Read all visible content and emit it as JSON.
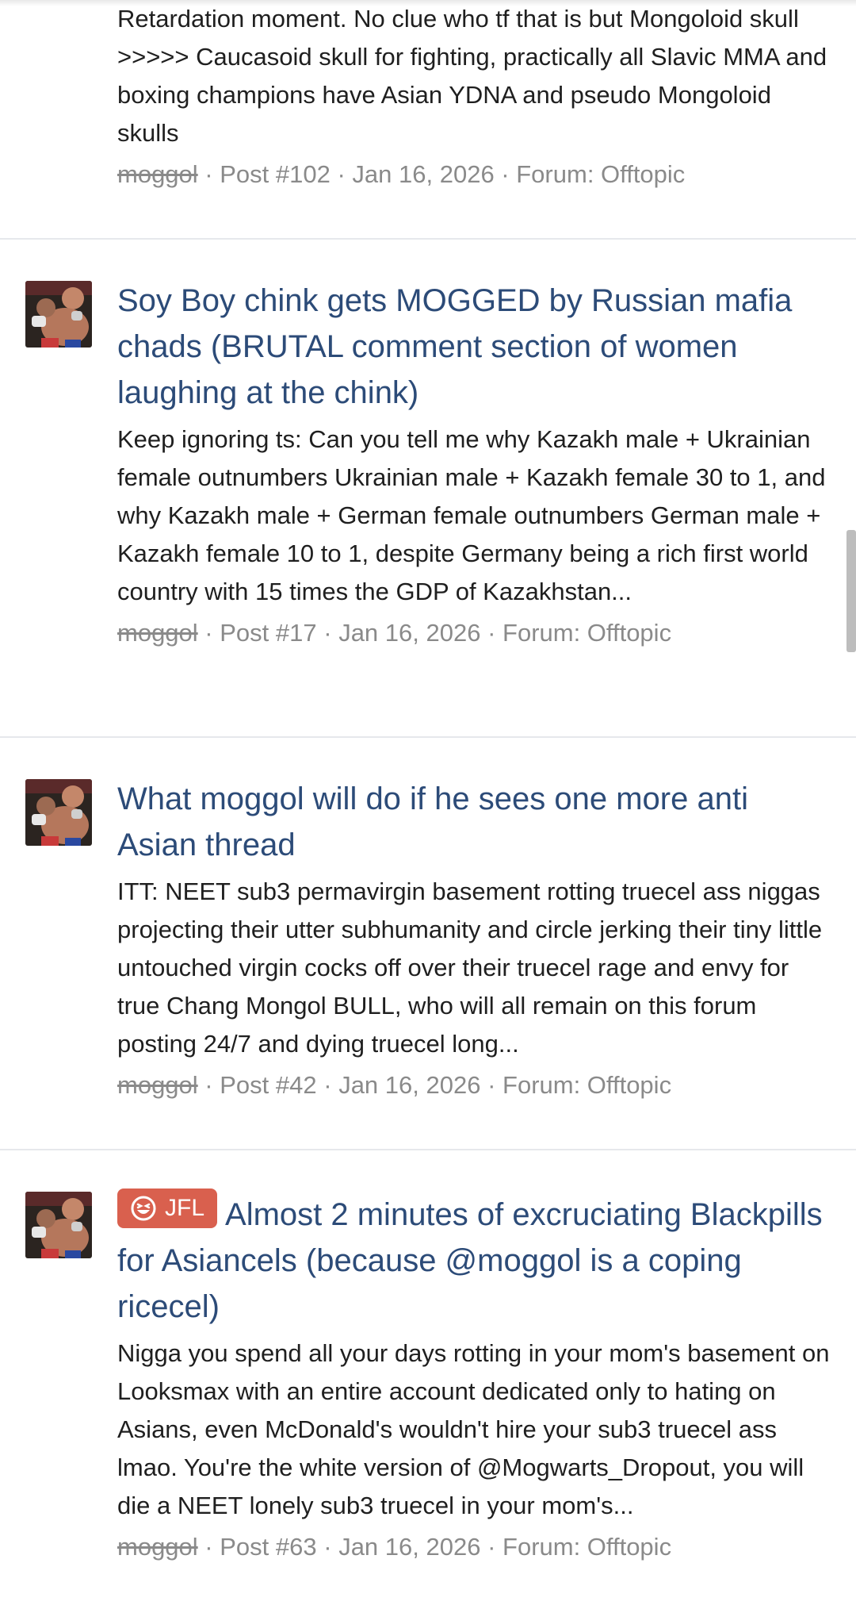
{
  "results": [
    {
      "title": "",
      "snippet": "Retardation moment. No clue who tf that is but Mongoloid skull >>>>> Caucasoid skull for fighting, practically all Slavic MMA and boxing champions have Asian YDNA and pseudo Mongoloid skulls",
      "user": "moggol",
      "post": "Post #102",
      "date": "Jan 16, 2026",
      "forum": "Forum: Offtopic"
    },
    {
      "title": "Soy Boy chink gets MOGGED by Russian mafia chads (BRUTAL comment section of women laughing at the chink)",
      "snippet": "Keep ignoring ts: Can you tell me why Kazakh male + Ukrainian female outnumbers Ukrainian male + Kazakh female 30 to 1, and why Kazakh male + German female outnumbers German male + Kazakh female 10 to 1, despite Germany being a rich first world country with 15 times the GDP of Kazakhstan...",
      "user": "moggol",
      "post": "Post #17",
      "date": "Jan 16, 2026",
      "forum": "Forum: Offtopic"
    },
    {
      "title": "What moggol will do if he sees one more anti Asian thread",
      "snippet": "ITT: NEET sub3 permavirgin basement rotting truecel ass niggas projecting their utter subhumanity and circle jerking their tiny little untouched virgin cocks off over their truecel rage and envy for true Chang Mongol BULL, who will all remain on this forum posting 24/7 and dying truecel long...",
      "user": "moggol",
      "post": "Post #42",
      "date": "Jan 16, 2026",
      "forum": "Forum: Offtopic"
    },
    {
      "prefix": "JFL",
      "title": "Almost 2 minutes of excruciating Blackpills for Asiancels (because @moggol is a coping ricecel)",
      "snippet": "Nigga you spend all your days rotting in your mom's basement on Looksmax with an entire account dedicated only to hating on Asians, even McDonald's wouldn't hire your sub3 truecel ass lmao. You're the white version of @Mogwarts_Dropout, you will die a NEET lonely sub3 truecel in your mom's...",
      "user": "moggol",
      "post": "Post #63",
      "date": "Jan 16, 2026",
      "forum": "Forum: Offtopic"
    }
  ],
  "separator": " · ",
  "colors": {
    "title": "#2c4b78",
    "meta": "#8a8a8a",
    "prefix_bg": "#d9604e",
    "divider": "#e6e8ec"
  },
  "icons": {
    "avatar": "avatar-image",
    "prefix": "laughing-face-icon"
  }
}
